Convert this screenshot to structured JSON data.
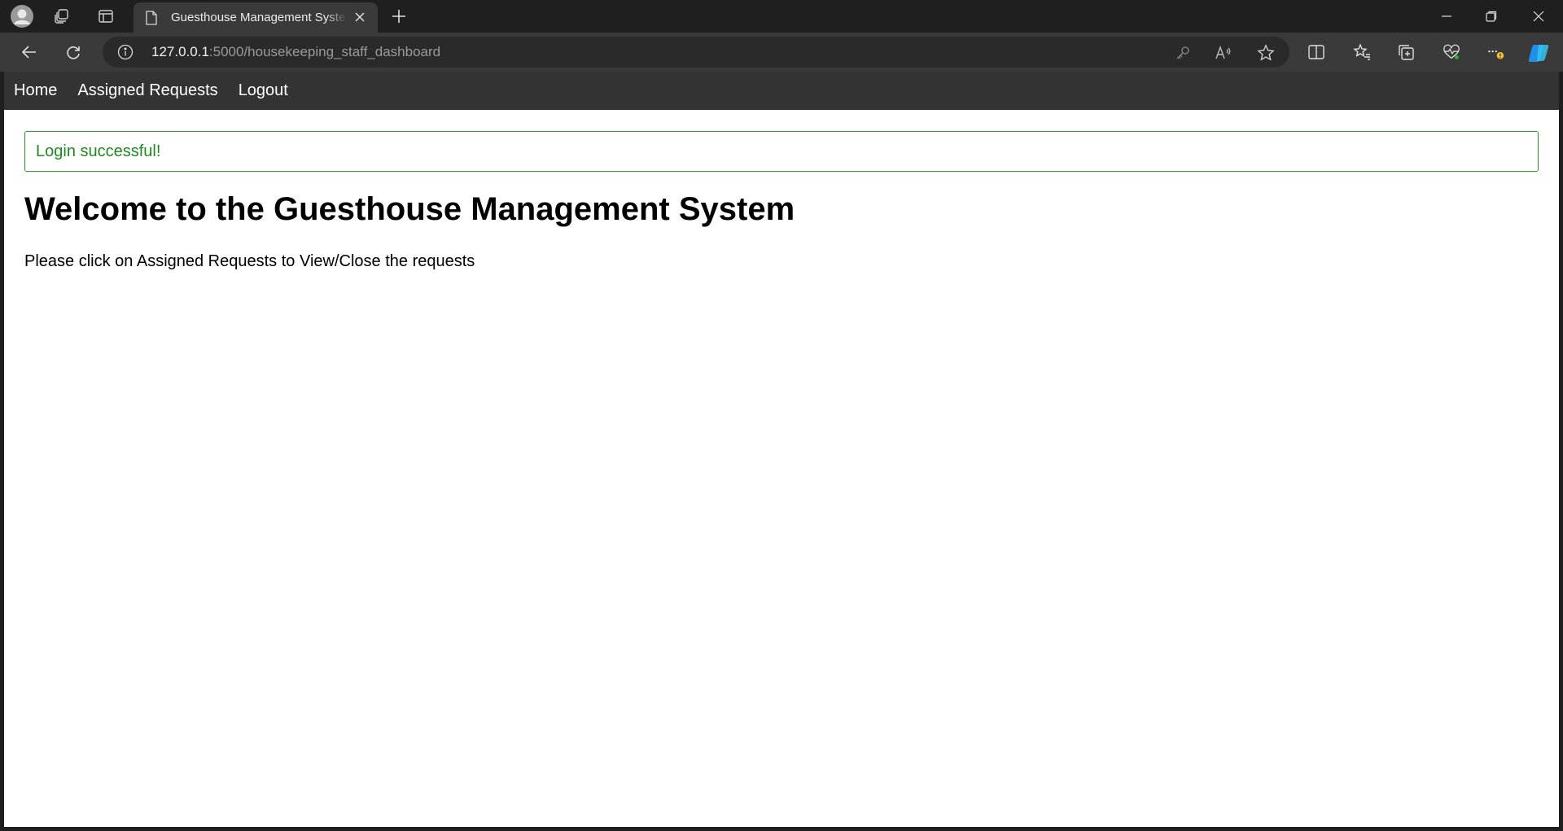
{
  "browser": {
    "tab": {
      "title": "Guesthouse Management System"
    },
    "address_bar": {
      "host": "127.0.0.1",
      "path": ":5000/housekeeping_staff_dashboard"
    },
    "accent_color": "#2aa02a",
    "icons": [
      "avatar-icon",
      "workspaces-icon",
      "tab-actions-icon",
      "document-icon",
      "close-icon",
      "plus-icon",
      "minimize-icon",
      "restore-icon",
      "back-icon",
      "reload-icon",
      "info-icon",
      "key-icon",
      "read-aloud-icon",
      "star-icon",
      "split-screen-icon",
      "favorites-icon",
      "collections-icon",
      "health-icon",
      "more-icon",
      "copilot-icon"
    ]
  },
  "nav": {
    "home": "Home",
    "assigned_requests": "Assigned Requests",
    "logout": "Logout"
  },
  "flash": {
    "message": "Login successful!",
    "color": "#1f8a1f"
  },
  "main": {
    "title": "Welcome to the Guesthouse Management System",
    "description": "Please click on Assigned Requests to View/Close the requests"
  }
}
